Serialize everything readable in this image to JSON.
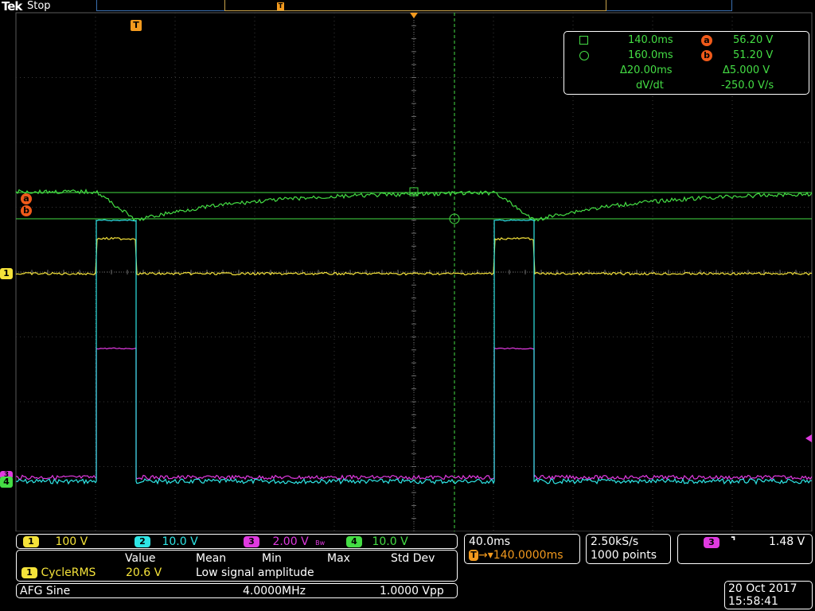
{
  "header": {
    "brand": "Tek",
    "acq_state": "Stop"
  },
  "record_marker": "T",
  "trigger_marker": "T",
  "cursors": {
    "a_time": "140.0ms",
    "b_time": "160.0ms",
    "a_value": "56.20 V",
    "b_value": "51.20 V",
    "delta_time": "Δ20.00ms",
    "delta_value": "Δ5.000 V",
    "rate_label": "dV/dt",
    "rate_value": "-250.0 V/s",
    "a_label": "a",
    "b_label": "b"
  },
  "left_markers": {
    "a": "a",
    "b": "b",
    "ch1": "1",
    "ch3": "3",
    "ch4": "4"
  },
  "channels": [
    {
      "id": "1",
      "scale": "100 V",
      "color": "#f5e33a"
    },
    {
      "id": "2",
      "scale": "10.0 V",
      "color": "#2ee6e6"
    },
    {
      "id": "3",
      "scale": "2.00 V",
      "color": "#e03ae0",
      "bw_icon": "Bw"
    },
    {
      "id": "4",
      "scale": "10.0 V",
      "color": "#44dd44"
    }
  ],
  "timebase": {
    "scale": "40.0ms",
    "position": "140.0000ms",
    "sample_rate": "2.50kS/s",
    "record_length": "1000 points"
  },
  "trigger": {
    "source": "3",
    "slope_icon": "falling-edge",
    "slope_symbol": "⌝",
    "level": "1.48 V"
  },
  "measurements": {
    "headers": [
      "Value",
      "Mean",
      "Min",
      "Max",
      "Std Dev"
    ],
    "row": {
      "channel": "1",
      "name": "CycleRMS",
      "value": "20.6 V",
      "note": "Low signal amplitude"
    }
  },
  "afg": {
    "label": "AFG  Sine",
    "frequency": "4.0000MHz",
    "amplitude": "1.0000 Vpp"
  },
  "datetime": {
    "date": "20 Oct  2017",
    "time": "15:58:41"
  }
}
